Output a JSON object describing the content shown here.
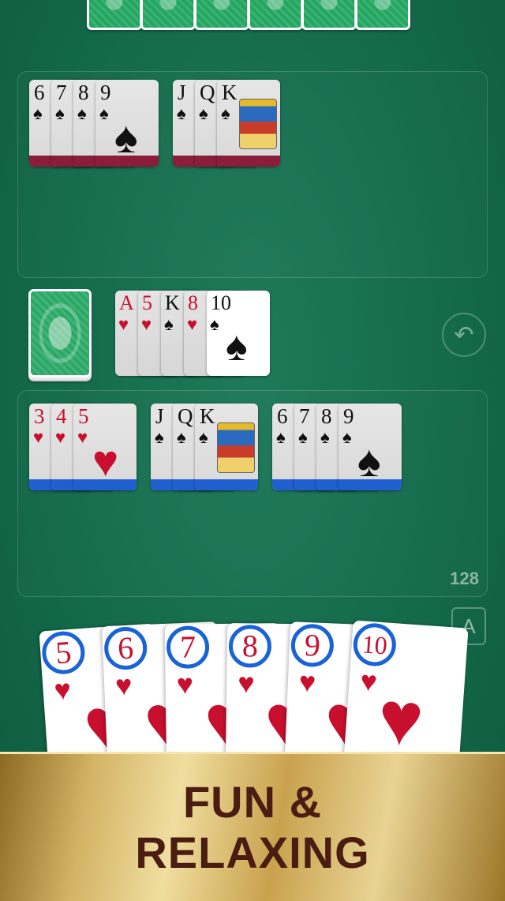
{
  "opponent": {
    "card_count": 6
  },
  "opponent_melds": [
    {
      "cards": [
        {
          "rank": "6",
          "suit": "♠"
        },
        {
          "rank": "7",
          "suit": "♠"
        },
        {
          "rank": "8",
          "suit": "♠"
        },
        {
          "rank": "9",
          "suit": "♠"
        }
      ],
      "band_color": "#8b1d3a"
    },
    {
      "cards": [
        {
          "rank": "J",
          "suit": "♠"
        },
        {
          "rank": "Q",
          "suit": "♠"
        },
        {
          "rank": "K",
          "suit": "♠"
        }
      ],
      "band_color": "#8b1d3a"
    }
  ],
  "discard_pile": [
    {
      "rank": "A",
      "suit": "♥"
    },
    {
      "rank": "5",
      "suit": "♥"
    },
    {
      "rank": "K",
      "suit": "♠"
    },
    {
      "rank": "8",
      "suit": "♥"
    },
    {
      "rank": "10",
      "suit": "♠"
    }
  ],
  "player_melds": [
    {
      "cards": [
        {
          "rank": "3",
          "suit": "♥"
        },
        {
          "rank": "4",
          "suit": "♥"
        },
        {
          "rank": "5",
          "suit": "♥"
        }
      ],
      "band_color": "#1f5fd0"
    },
    {
      "cards": [
        {
          "rank": "J",
          "suit": "♠"
        },
        {
          "rank": "Q",
          "suit": "♠"
        },
        {
          "rank": "K",
          "suit": "♠"
        }
      ],
      "band_color": "#1f5fd0"
    },
    {
      "cards": [
        {
          "rank": "6",
          "suit": "♠"
        },
        {
          "rank": "7",
          "suit": "♠"
        },
        {
          "rank": "8",
          "suit": "♠"
        },
        {
          "rank": "9",
          "suit": "♠"
        }
      ],
      "band_color": "#1f5fd0"
    }
  ],
  "score": "128",
  "sort_button": {
    "label": "A"
  },
  "undo_button": {
    "icon": "undo-arrow-icon",
    "glyph": "↶"
  },
  "player_hand": [
    {
      "rank": "5",
      "suit": "♥"
    },
    {
      "rank": "6",
      "suit": "♥"
    },
    {
      "rank": "7",
      "suit": "♥"
    },
    {
      "rank": "8",
      "suit": "♥"
    },
    {
      "rank": "9",
      "suit": "♥"
    },
    {
      "rank": "10",
      "suit": "♥"
    }
  ],
  "banner": {
    "line1": "FUN &",
    "line2": "RELAXING"
  },
  "colors": {
    "felt": "#146a4b",
    "red_suit": "#c8102e",
    "player_band": "#1f5fd0",
    "opponent_band": "#8b1d3a"
  }
}
